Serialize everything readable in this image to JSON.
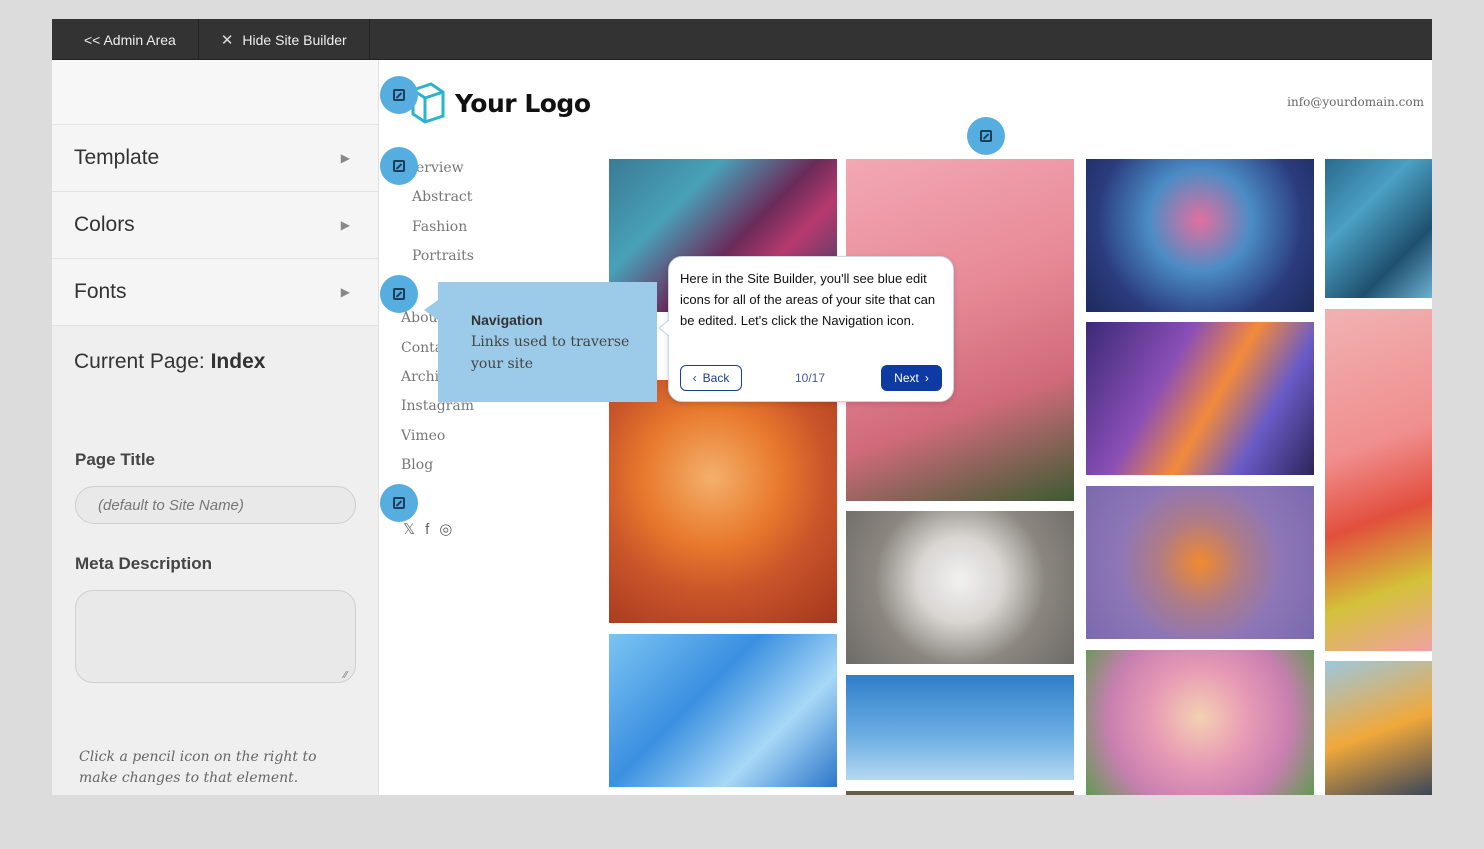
{
  "topbar": {
    "admin_label": "<< Admin Area",
    "hide_label": "Hide Site Builder",
    "hide_icon": "close-icon"
  },
  "sidebar": {
    "items": [
      {
        "label": "Template",
        "icon": "triangle-right-icon"
      },
      {
        "label": "Colors",
        "icon": "triangle-right-icon"
      },
      {
        "label": "Fonts",
        "icon": "triangle-right-icon"
      }
    ],
    "current_page_label": "Current Page:",
    "current_page_value": "Index",
    "page_title_label": "Page Title",
    "page_title_placeholder": "(default to Site Name)",
    "page_title_value": "",
    "meta_description_label": "Meta Description",
    "meta_description_value": "",
    "help_text": "Click a pencil icon on the right to make changes to that element."
  },
  "site": {
    "logo_text": "Your Logo",
    "email": "info@yourdomain.com",
    "nav": [
      "erview",
      "Abstract",
      "Fashion",
      "Portraits",
      "About",
      "Conta",
      "Archi",
      "Instagram",
      "Vimeo",
      "Blog"
    ],
    "social": [
      {
        "icon": "x-twitter-icon",
        "glyph": "𝕏"
      },
      {
        "icon": "facebook-icon",
        "glyph": "f"
      },
      {
        "icon": "instagram-icon",
        "glyph": "◎"
      }
    ],
    "edit_icon_color": "#55ade0"
  },
  "navigation_tooltip": {
    "title": "Navigation",
    "body": "Links used to traverse your site"
  },
  "tour": {
    "text": "Here in the Site Builder, you'll see blue edit icons for all of the areas of your site that can be edited. Let's click the Navigation icon.",
    "back_label": "Back",
    "progress": "10/17",
    "next_label": "Next",
    "accent_color": "#0d3aa3"
  }
}
